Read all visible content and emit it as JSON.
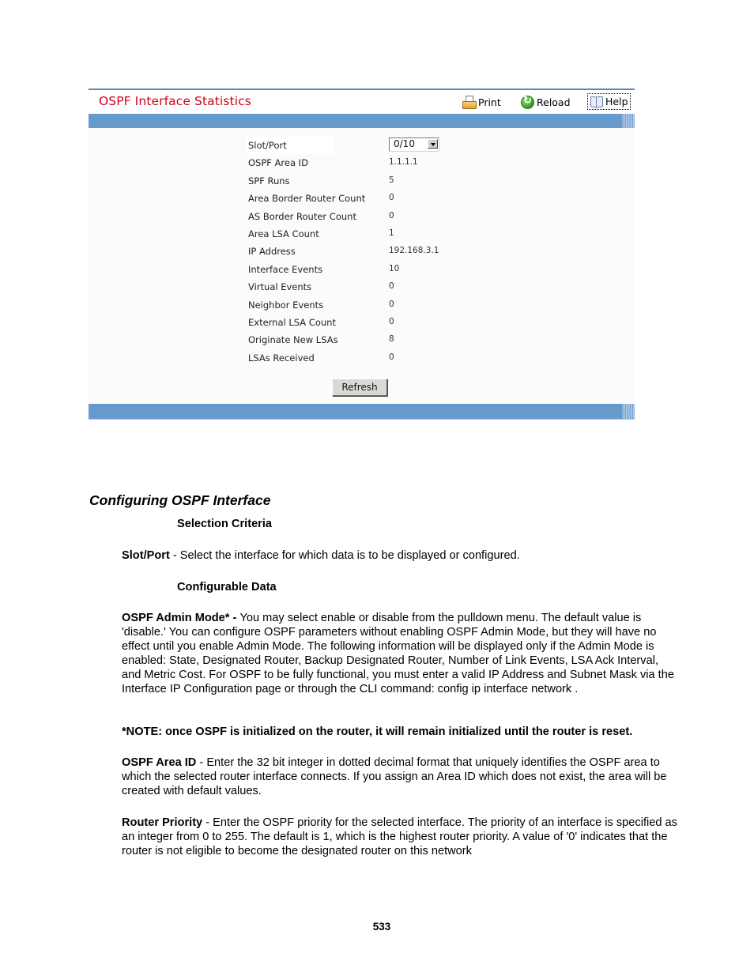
{
  "ui": {
    "title": "OSPF Interface Statistics",
    "toolbar": {
      "print_label": "Print",
      "reload_label": "Reload",
      "help_label": "Help",
      "print_icon": "printer-icon",
      "reload_icon": "reload-icon",
      "help_icon": "book-icon"
    },
    "slot_port": {
      "label": "Slot/Port",
      "selected": "0/10"
    },
    "stats": [
      {
        "label": "OSPF Area ID",
        "value": "1.1.1.1"
      },
      {
        "label": "SPF Runs",
        "value": "5"
      },
      {
        "label": "Area Border Router Count",
        "value": "0"
      },
      {
        "label": "AS Border Router Count",
        "value": "0"
      },
      {
        "label": "Area LSA Count",
        "value": "1"
      },
      {
        "label": "IP Address",
        "value": "192.168.3.1"
      },
      {
        "label": "Interface Events",
        "value": "10"
      },
      {
        "label": "Virtual Events",
        "value": "0"
      },
      {
        "label": "Neighbor Events",
        "value": "0"
      },
      {
        "label": "External LSA Count",
        "value": "0"
      },
      {
        "label": "Originate New LSAs",
        "value": "8"
      },
      {
        "label": "LSAs Received",
        "value": "0"
      }
    ],
    "refresh_label": "Refresh",
    "colors": {
      "title": "#d0021b",
      "band": "#6699cc"
    }
  },
  "doc": {
    "section_title": "Configuring OSPF Interface",
    "selection_criteria": "Selection Criteria",
    "slot_port": {
      "term": "Slot/Port",
      "text": " - Select the interface for which data is to be displayed or configured."
    },
    "configurable_data": "Configurable Data",
    "admin_mode": {
      "term": "OSPF Admin Mode* - ",
      "text": "You may select enable or disable from the pulldown menu. The default value is 'disable.' You can configure OSPF parameters without enabling OSPF Admin Mode, but they will have no effect until you enable Admin Mode. The following information will be displayed only if the Admin Mode is enabled: State, Designated Router, Backup Designated Router, Number of Link Events, LSA Ack Interval, and Metric Cost. For OSPF to be fully functional, you must enter a valid IP Address and Subnet Mask via the Interface IP Configuration page or through the CLI command: config ip interface network ."
    },
    "note": "*NOTE: once OSPF is initialized on the router, it will remain initialized until the router is reset.",
    "area_id": {
      "term": "OSPF Area ID",
      "text": " - Enter the 32 bit integer in dotted decimal format that uniquely identifies the OSPF area to which the selected router interface connects. If you assign an Area ID which does not exist, the area will be created with default values."
    },
    "router_priority": {
      "term": "Router Priority",
      "text": " - Enter the OSPF priority for the selected interface. The priority of an interface is specified as an integer from 0 to 255. The default is 1, which is the highest router priority. A value of '0' indicates that the router is not eligible to become the designated router on this network"
    },
    "page_number": "533"
  }
}
